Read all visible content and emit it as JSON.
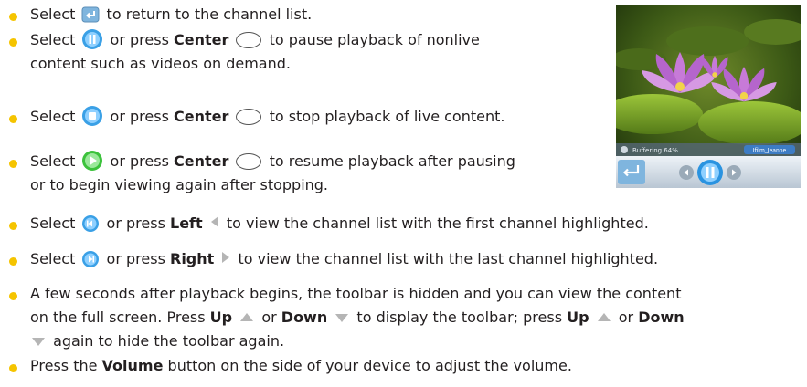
{
  "colors": {
    "bullet": "#f5c400",
    "icon_blue": "#3aa0e6",
    "icon_green": "#3cc23c",
    "arrow_gray": "#b5b5b5"
  },
  "icons": {
    "return": "return-arrow-icon",
    "pause": "pause-icon",
    "stop": "stop-icon",
    "play": "play-icon",
    "prev": "previous-channel-icon",
    "next": "next-channel-icon",
    "center_key": "center-key-icon"
  },
  "bullets": [
    {
      "a": "Select",
      "b": "to return to the channel list."
    },
    {
      "a": "Select",
      "b": "or press",
      "k": "Center",
      "c": "to pause playback of nonlive",
      "line2": "content such as videos on demand."
    },
    {
      "a": "Select",
      "b": "or press",
      "k": "Center",
      "c": "to stop playback of live content."
    },
    {
      "a": "Select",
      "b": "or press",
      "k": "Center",
      "c": "to resume playback after pausing",
      "line2": "or to begin viewing again after stopping."
    },
    {
      "a": "Select",
      "b": "or press",
      "k": "Left",
      "c": "to view the channel list with the first channel highlighted."
    },
    {
      "a": "Select",
      "b": "or press",
      "k": "Right",
      "c": "to view the channel list with the last channel highlighted."
    },
    {
      "l1": "A few seconds after playback begins, the toolbar is hidden and you can view the content",
      "l2a": "on the full screen. Press",
      "k1": "Up",
      "or1": "or",
      "k2": "Down",
      "l2b": "to display the toolbar; press",
      "k3": "Up",
      "or2": "or",
      "k4": "Down",
      "l3": "again to hide the toolbar again."
    },
    {
      "a": "Press the",
      "k": "Volume",
      "b": "button on the side of your device to adjust the volume."
    }
  ],
  "screenshot": {
    "status_text": "Buffering 64%",
    "channel_tag": "Ifilm_Jeanne"
  }
}
